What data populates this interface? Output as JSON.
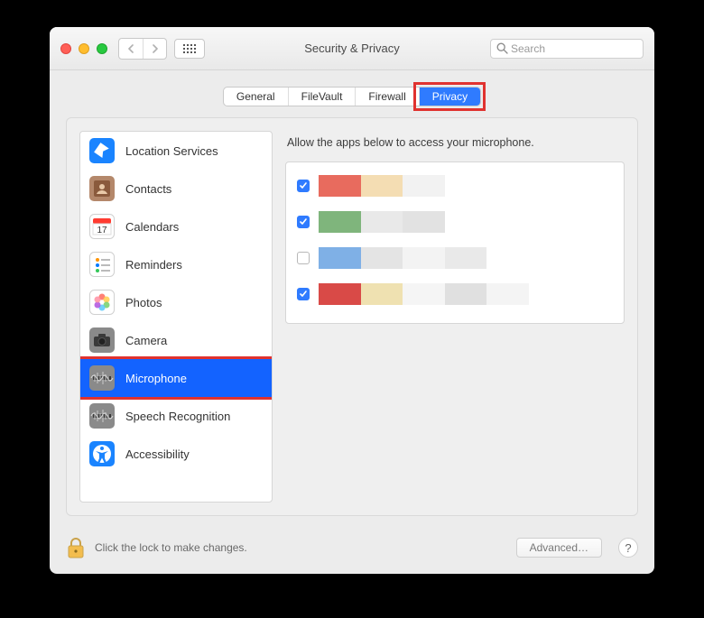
{
  "window": {
    "title": "Security & Privacy"
  },
  "search": {
    "placeholder": "Search",
    "value": ""
  },
  "tabs": [
    {
      "id": "general",
      "label": "General",
      "active": false
    },
    {
      "id": "filevault",
      "label": "FileVault",
      "active": false
    },
    {
      "id": "firewall",
      "label": "Firewall",
      "active": false
    },
    {
      "id": "privacy",
      "label": "Privacy",
      "active": true
    }
  ],
  "sidebar": {
    "items": [
      {
        "id": "location",
        "label": "Location Services",
        "icon": "location-icon",
        "bg": "#1a84ff"
      },
      {
        "id": "contacts",
        "label": "Contacts",
        "icon": "contacts-icon",
        "bg": "#b4886b"
      },
      {
        "id": "calendars",
        "label": "Calendars",
        "icon": "calendar-icon",
        "bg": "#ffffff"
      },
      {
        "id": "reminders",
        "label": "Reminders",
        "icon": "reminders-icon",
        "bg": "#ffffff"
      },
      {
        "id": "photos",
        "label": "Photos",
        "icon": "photos-icon",
        "bg": "#ffffff"
      },
      {
        "id": "camera",
        "label": "Camera",
        "icon": "camera-icon",
        "bg": "#8a8a8a"
      },
      {
        "id": "microphone",
        "label": "Microphone",
        "icon": "microphone-icon",
        "bg": "#8a8a8a",
        "selected": true
      },
      {
        "id": "speech",
        "label": "Speech Recognition",
        "icon": "speech-icon",
        "bg": "#8a8a8a"
      },
      {
        "id": "accessibility",
        "label": "Accessibility",
        "icon": "accessibility-icon",
        "bg": "#1a84ff"
      }
    ]
  },
  "content": {
    "description": "Allow the apps below to access your microphone.",
    "apps": [
      {
        "checked": true,
        "swatches": [
          "#e86b5e",
          "#f4ddb3",
          "#f2f2f2",
          "#ffffff",
          "#ffffff",
          "#ffffff",
          "#ffffff"
        ]
      },
      {
        "checked": true,
        "swatches": [
          "#7fb57c",
          "#e9e9e9",
          "#e2e2e2",
          "#ffffff",
          "#ffffff",
          "#ffffff",
          "#ffffff"
        ]
      },
      {
        "checked": false,
        "swatches": [
          "#7fb0e6",
          "#e4e4e4",
          "#f3f3f3",
          "#e9e9e9",
          "#ffffff",
          "#ffffff",
          "#ffffff"
        ]
      },
      {
        "checked": true,
        "swatches": [
          "#d94a47",
          "#efe1b1",
          "#f5f5f5",
          "#e0e0e0",
          "#f4f4f4",
          "#ffffff",
          "#ffffff"
        ]
      }
    ]
  },
  "footer": {
    "lock_text": "Click the lock to make changes.",
    "advanced_label": "Advanced…"
  },
  "highlights": {
    "privacy_tab": true,
    "microphone_row": true
  }
}
